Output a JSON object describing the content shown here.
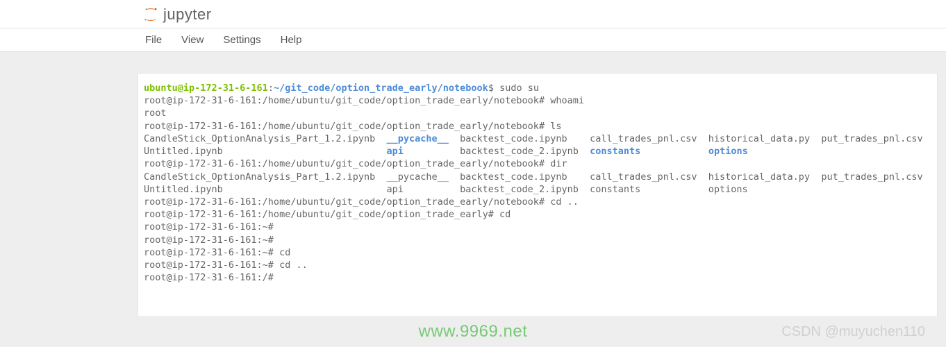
{
  "header": {
    "logo_text": "jupyter"
  },
  "menubar": {
    "items": [
      "File",
      "View",
      "Settings",
      "Help"
    ]
  },
  "terminal": {
    "prompt_user": "ubuntu@ip-172-31-6-161",
    "prompt_sep": ":",
    "prompt_path": "~/git_code/option_trade_early/notebook",
    "prompt_dollar": "$ ",
    "cmd_sudo": "sudo su",
    "line_whoami": "root@ip-172-31-6-161:/home/ubuntu/git_code/option_trade_early/notebook# whoami",
    "line_root": "root",
    "line_ls": "root@ip-172-31-6-161:/home/ubuntu/git_code/option_trade_early/notebook# ls",
    "ls_row1_a": "CandleStick_OptionAnalysis_Part_1.2.ipynb  ",
    "ls_row1_b": "__pycache__",
    "ls_row1_c": "  backtest_code.ipynb    call_trades_pnl.csv  historical_data.py  put_trades_pnl.csv",
    "ls_row2_a": "Untitled.ipynb                             ",
    "ls_row2_b": "api",
    "ls_row2_c": "          backtest_code_2.ipynb  ",
    "ls_row2_d": "constants",
    "ls_row2_e": "            ",
    "ls_row2_f": "options",
    "line_dir": "root@ip-172-31-6-161:/home/ubuntu/git_code/option_trade_early/notebook# dir",
    "dir_row1": "CandleStick_OptionAnalysis_Part_1.2.ipynb  __pycache__  backtest_code.ipynb    call_trades_pnl.csv  historical_data.py  put_trades_pnl.csv",
    "dir_row2": "Untitled.ipynb                             api          backtest_code_2.ipynb  constants            options",
    "line_cdup": "root@ip-172-31-6-161:/home/ubuntu/git_code/option_trade_early/notebook# cd ..",
    "line_cd": "root@ip-172-31-6-161:/home/ubuntu/git_code/option_trade_early# cd",
    "line_p1": "root@ip-172-31-6-161:~#",
    "line_p2": "root@ip-172-31-6-161:~#",
    "line_p3": "root@ip-172-31-6-161:~# cd",
    "line_p4": "root@ip-172-31-6-161:~# cd ..",
    "line_p5": "root@ip-172-31-6-161:/#"
  },
  "watermarks": {
    "center": "www.9969.net",
    "right": "CSDN @muyuchen110"
  }
}
